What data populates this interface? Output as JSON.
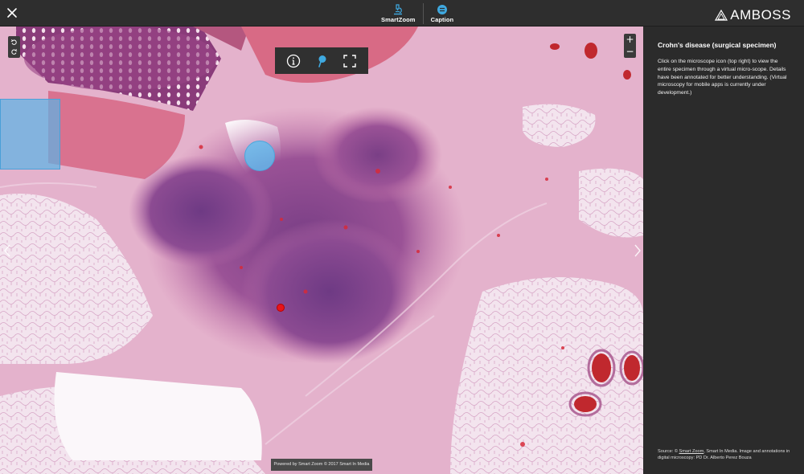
{
  "topbar": {
    "nav": [
      {
        "label": "SmartZoom",
        "icon": "microscope-icon"
      },
      {
        "label": "Caption",
        "icon": "caption-icon"
      }
    ],
    "brand": "AMBOSS"
  },
  "viewer": {
    "credit": "Powered by Smart Zoom © 2017 Smart In Media",
    "zoom_in": "+",
    "zoom_out": "−"
  },
  "panel": {
    "title": "Crohn's disease (surgical specimen)",
    "body": "Click on the microscope icon (top right) to view the entire specimen through a virtual micro-scope. Details have been annotated for better understanding. (Virtual microscopy for mobile apps is currently under development.)",
    "source_prefix": "Source: © ",
    "source_link": "Smart Zoom",
    "source_rest": ", Smart In Media. Image and annotations in digital microscopy: PD Dr. Alberto Perez Bouza"
  },
  "colors": {
    "accent_blue": "#3fa9e0",
    "annotation_red": "#e8141a",
    "panel_bg": "#2b2b2b"
  }
}
